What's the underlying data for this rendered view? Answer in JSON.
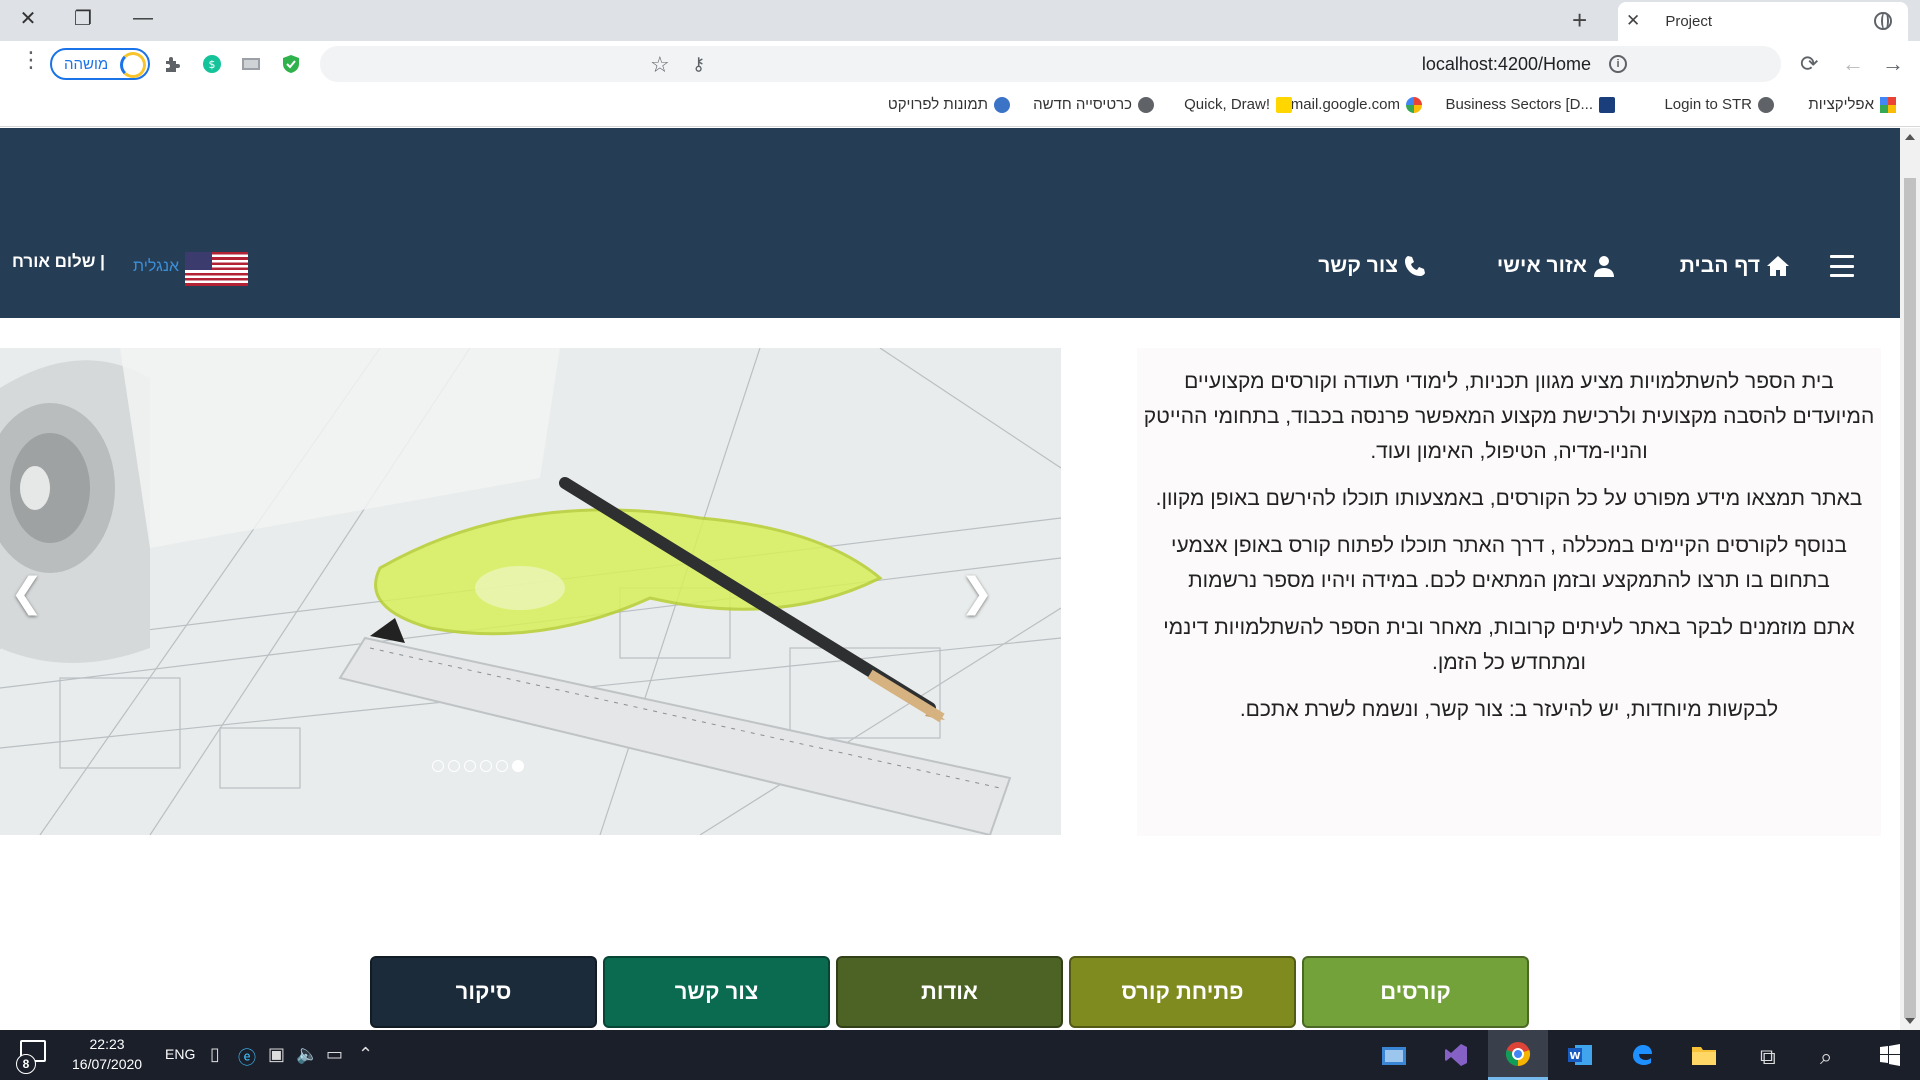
{
  "browser": {
    "tab_title": "Project",
    "url": "localhost:4200/Home",
    "profile_label": "מושהה",
    "bookmarks": [
      {
        "label": "אפליקציות",
        "icon": "apps-grid-icon"
      },
      {
        "label": "Login to STR",
        "icon": "globe-icon"
      },
      {
        "label": "Business Sectors [D...",
        "icon": "dnka-icon"
      },
      {
        "label": "mail.google.com",
        "icon": "google-icon"
      },
      {
        "label": "Quick, Draw!",
        "icon": "pencil-icon"
      },
      {
        "label": "כרטיסייה חדשה",
        "icon": "globe-icon"
      },
      {
        "label": "תמונות לפרויקט",
        "icon": "bird-icon"
      }
    ]
  },
  "site": {
    "nav": {
      "home": "דף הבית",
      "personal_area": "אזור אישי",
      "contact": "צור קשר",
      "language": "אנגלית",
      "greeting": "שלום אורח |"
    },
    "about_paragraphs": [
      "בית הספר להשתלמויות מציע מגוון תכניות, לימודי תעודה וקורסים מקצועיים המיועדים להסבה מקצועית ולרכישת מקצוע המאפשר פרנסה בכבוד, בתחומי ההייטק והניו-מדיה, הטיפול, האימון ועוד.",
      "באתר תמצאו מידע מפורט על כל הקורסים, באמצעותו תוכלו להירשם באופן מקוון.",
      "בנוסף לקורסים הקיימים במכללה , דרך האתר תוכלו לפתוח קורס באופן אצמעי בתחום בו תרצו להתמקצע ובזמן המתאים לכם. במידה ויהיו מספר נרשמות",
      "אתם מוזמנים לבקר באתר לעיתים קרובות, מאחר ובית הספר להשתלמויות דינמי ומתחדש כל הזמן.",
      "לבקשות מיוחדות, יש להיעזר ב: צור קשר, ונשמח לשרת אתכם."
    ],
    "carousel": {
      "slide_count": 6,
      "active_index": 5
    },
    "buttons": {
      "courses": "קורסים",
      "open_course": "פתיחת קורס",
      "about": "אודות",
      "contact": "צור קשר",
      "review": "סיקור"
    },
    "colors": {
      "nav_bg": "#263d56",
      "courses_btn": "#73a23a",
      "open_course_btn": "#7f8a1f",
      "about_btn": "#4d6325",
      "contact_btn": "#0b6b50",
      "review_btn": "#1c2b3a"
    }
  },
  "taskbar": {
    "time": "22:23",
    "date": "16/07/2020",
    "lang": "ENG",
    "notification_count": "8"
  }
}
